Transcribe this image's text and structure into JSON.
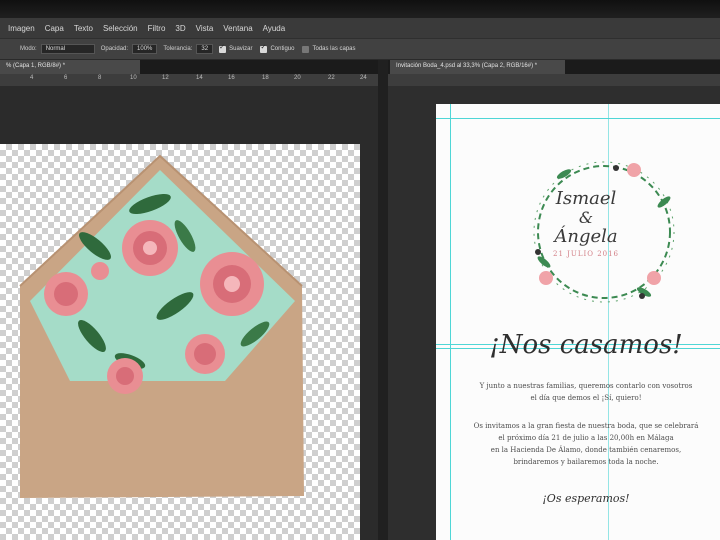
{
  "menubar": {
    "items": [
      "Imagen",
      "Capa",
      "Texto",
      "Selección",
      "Filtro",
      "3D",
      "Vista",
      "Ventana",
      "Ayuda"
    ]
  },
  "options": {
    "mode_label": "Modo:",
    "mode_value": "Normal",
    "opacity_label": "Opacidad:",
    "opacity_value": "100%",
    "tolerance_label": "Tolerancia:",
    "tolerance_value": "32",
    "antialias_label": "Suavizar",
    "contiguous_label": "Contiguo",
    "all_layers_label": "Todas las capas"
  },
  "left_doc": {
    "tab_label": "% (Capa 1, RGB/8#) *",
    "ruler_ticks": [
      "4",
      "6",
      "8",
      "10",
      "12",
      "14",
      "16",
      "18",
      "20",
      "22",
      "24"
    ]
  },
  "right_doc": {
    "tab_label": "Invitación Boda_4.psd al 33,3% (Capa 2, RGB/16#) *"
  },
  "invitation": {
    "name1": "Ismael",
    "amp": "&",
    "name2": "Ángela",
    "date": "21 JULIO 2016",
    "headline": "¡Nos casamos!",
    "para1_line1": "Y junto a nuestras familias, queremos contarlo con vosotros",
    "para1_line2": "el día que demos el ¡Sí, quiero!",
    "para2_line1": "Os invitamos a la gran fiesta de nuestra boda, que se celebrará",
    "para2_line2": "el próximo día 21 de julio a las 20,00h en Málaga",
    "para2_line3": "en la Hacienda De Álamo, donde también cenaremos,",
    "para2_line4": "brindaremos y bailaremos toda la noche.",
    "closing": "¡Os esperamos!"
  },
  "colors": {
    "envelope": "#c9a585",
    "liner_bg": "#a5dcc8",
    "rose": "#e98e93",
    "leaf": "#2f6a3c",
    "guide": "#4fd6d6"
  }
}
